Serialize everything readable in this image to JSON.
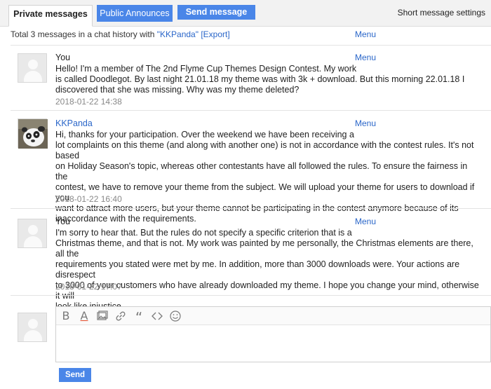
{
  "tabs": {
    "private": "Private messages",
    "public": "Public Announces",
    "send": "Send message",
    "settings": "Short message settings"
  },
  "summary": {
    "prefix": "Total 3 messages in a chat history with ",
    "name": "\"KKPanda\"",
    "export": "[Export]",
    "menu": "Menu"
  },
  "messages": [
    {
      "sender": "You",
      "menu": "Menu",
      "lines": [
        "Hello! I'm a member of The 2nd Flyme Cup Themes Design Contest. My work",
        "is called Doodlegot. By last night 21.01.18 my theme was with 3k + download. But this morning 22.01.18 I",
        "discovered that she was missing. Why was my theme deleted?"
      ],
      "time": "2018-01-22 14:38"
    },
    {
      "sender": "KKPanda",
      "menu": "Menu",
      "lines": [
        "Hi, thanks for your participation. Over the weekend we have been receiving a",
        "lot complaints on this theme (and along with another one) is not in accordance with the contest rules. It's not based",
        "on Holiday Season's topic, whereas other contestants have all followed the rules. To ensure the fairness in the",
        "contest, we have to remove your theme from the subject. We will upload your theme for users to download if you",
        "want to attract more users, but your theme cannot be participating in the contest anymore because of its",
        "inaccordance with the requirements."
      ],
      "time": "2018-01-22 16:40"
    },
    {
      "sender": "You",
      "menu": "Menu",
      "lines": [
        "I'm sorry to hear that. But the rules do not specify a specific criterion that is a",
        "Christmas theme, and that is not. My work was painted by me personally, the Christmas elements are there, all the",
        "requirements you stated were met by me. In addition, more than 3000 downloads were. Your actions are disrespect",
        "to 3000 of your customers who have already downloaded my theme. I hope you change your mind, otherwise it will",
        "look like injustice."
      ],
      "time": "2018-01-22 17:07"
    }
  ],
  "compose": {
    "bold": "B",
    "font_color": "A",
    "quote": "“",
    "send": "Send"
  },
  "colors": {
    "accent": "#4a86e8",
    "link": "#2a66c9"
  }
}
